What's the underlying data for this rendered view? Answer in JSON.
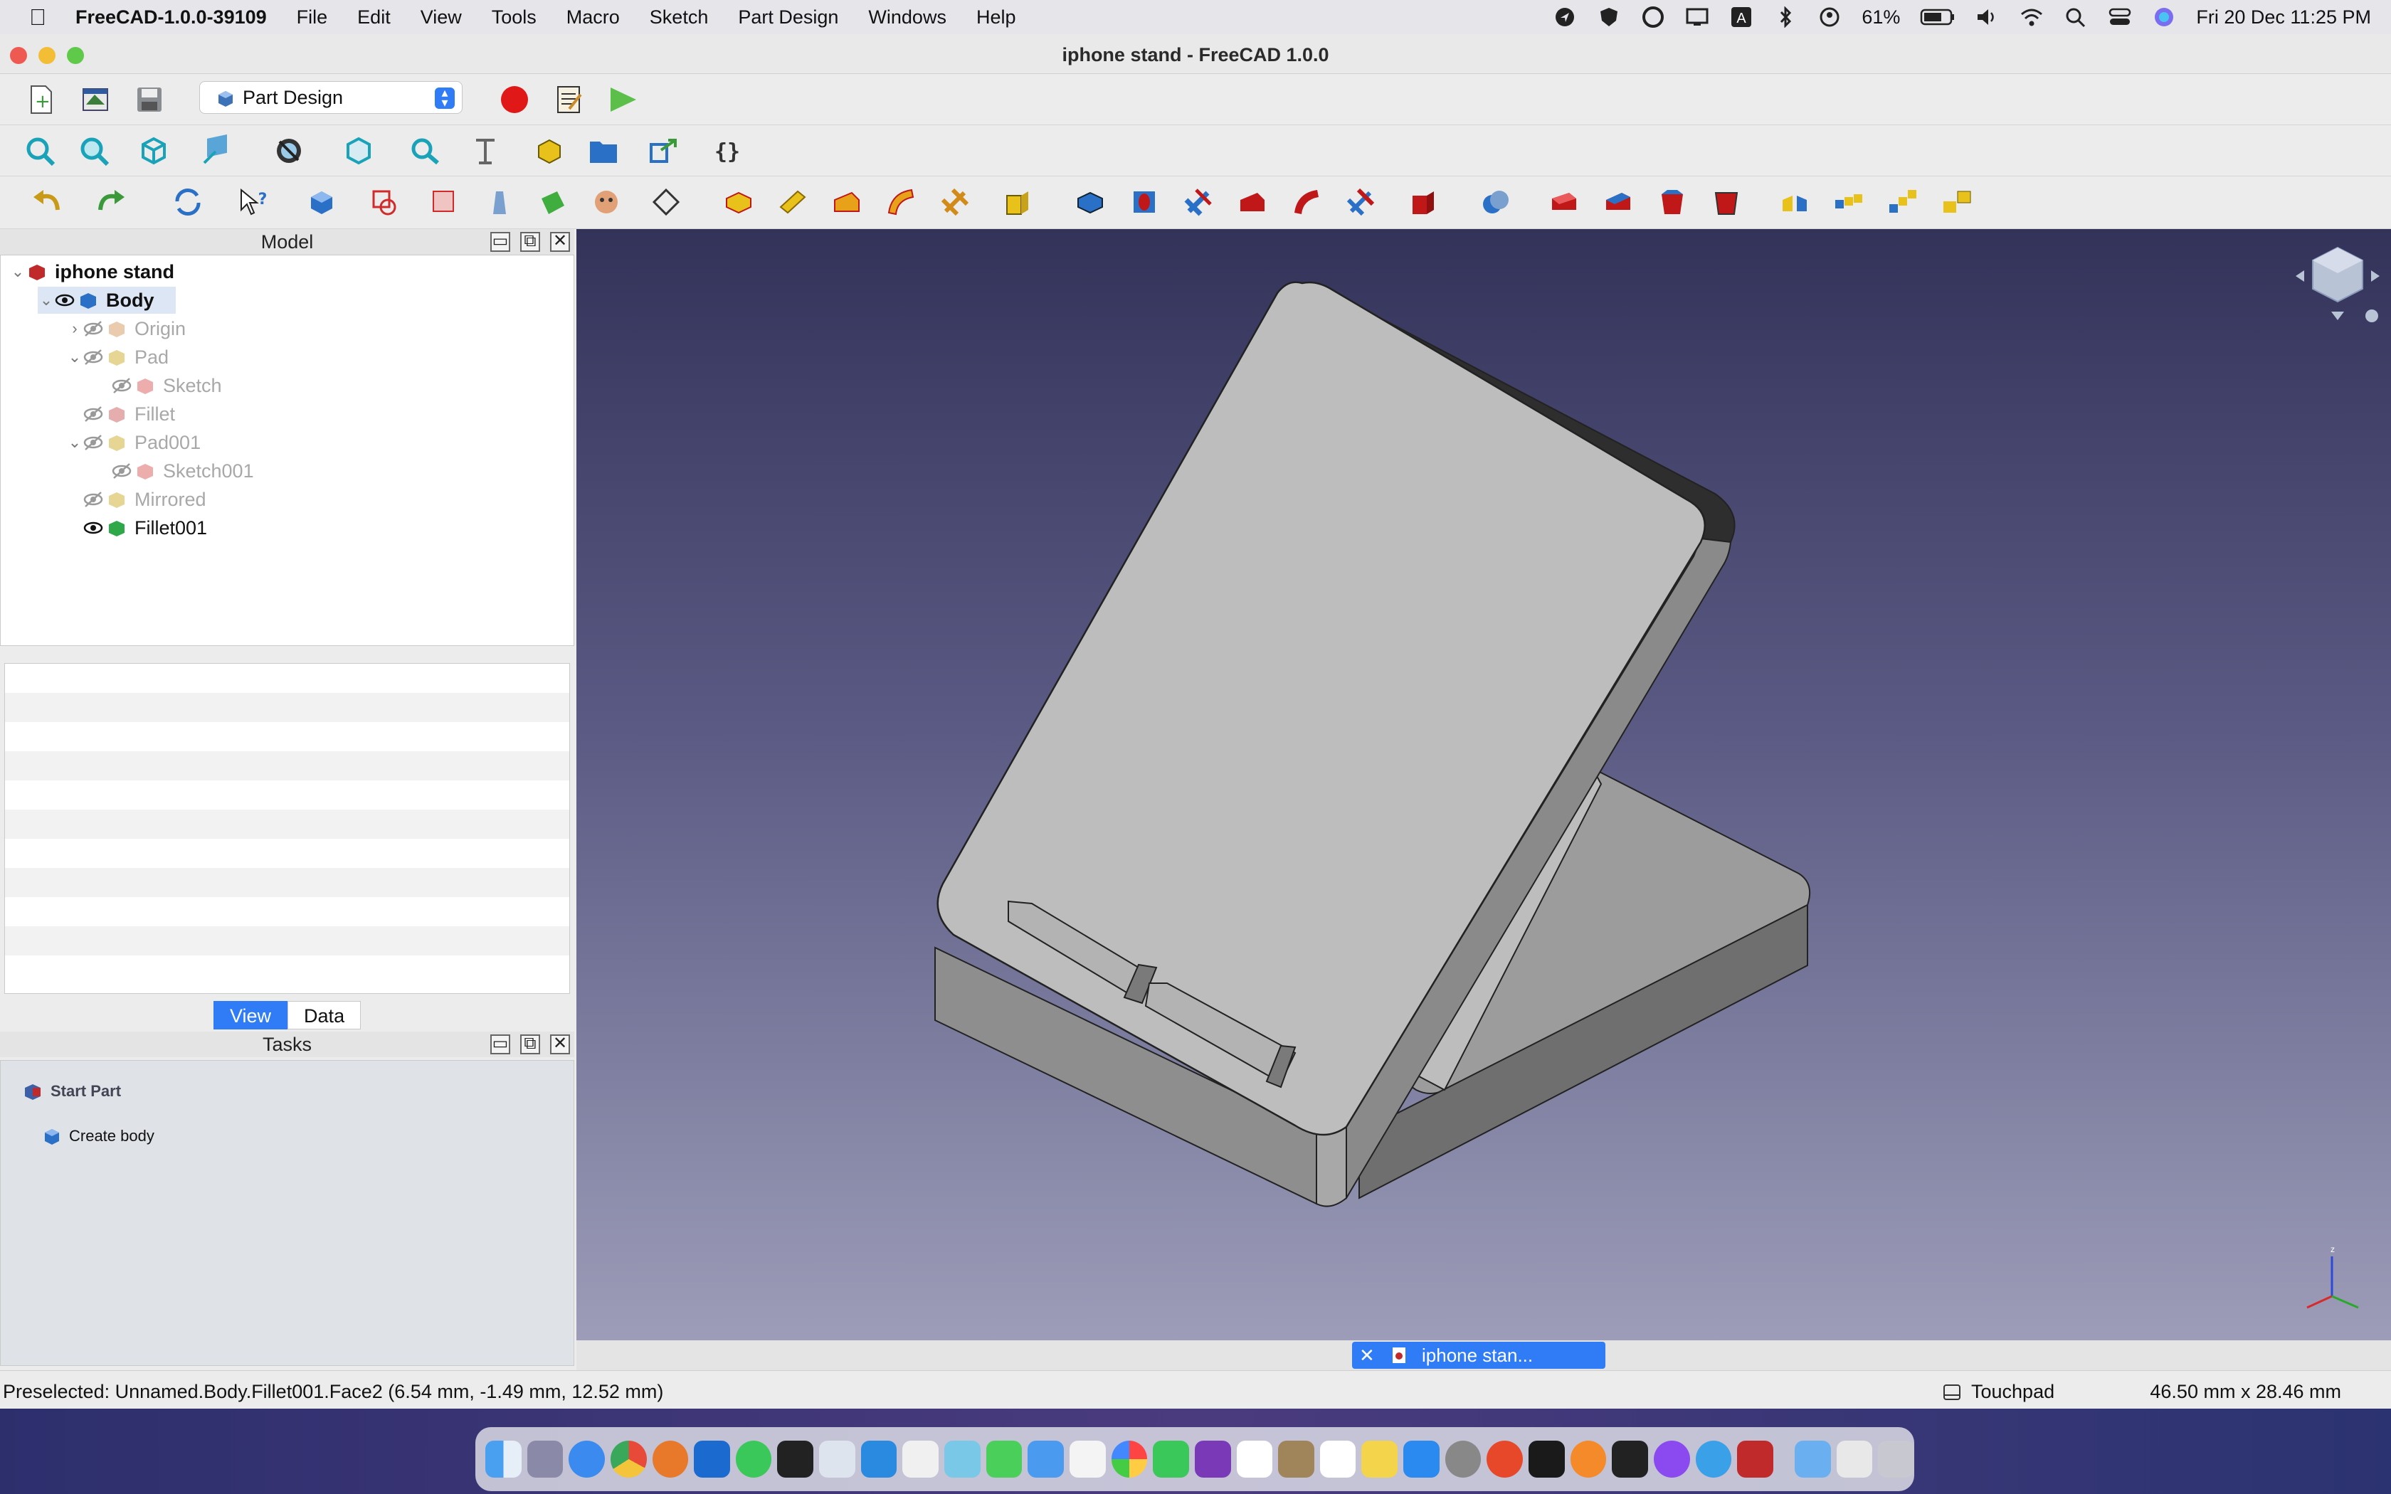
{
  "menubar": {
    "app_name": "FreeCAD-1.0.0-39109",
    "items": [
      "File",
      "Edit",
      "View",
      "Tools",
      "Macro",
      "Sketch",
      "Part Design",
      "Windows",
      "Help"
    ],
    "battery": "61%",
    "clock": "Fri 20 Dec  11:25 PM"
  },
  "window": {
    "title": "iphone stand - FreeCAD 1.0.0"
  },
  "toolbar": {
    "workbench": "Part Design"
  },
  "model_panel": {
    "title": "Model",
    "tree": [
      {
        "label": "iphone stand",
        "level": 0,
        "bold": true,
        "dim": false,
        "expanded": true
      },
      {
        "label": "Body",
        "level": 1,
        "bold": true,
        "dim": false,
        "expanded": true,
        "selected": true
      },
      {
        "label": "Origin",
        "level": 2,
        "dim": true,
        "expanded": false
      },
      {
        "label": "Pad",
        "level": 2,
        "dim": true,
        "expanded": true
      },
      {
        "label": "Sketch",
        "level": 3,
        "dim": true
      },
      {
        "label": "Fillet",
        "level": 2,
        "dim": true
      },
      {
        "label": "Pad001",
        "level": 2,
        "dim": true,
        "expanded": true
      },
      {
        "label": "Sketch001",
        "level": 3,
        "dim": true
      },
      {
        "label": "Mirrored",
        "level": 2,
        "dim": true
      },
      {
        "label": "Fillet001",
        "level": 2,
        "dim": false
      }
    ]
  },
  "property_tabs": {
    "view": "View",
    "data": "Data"
  },
  "tasks_panel": {
    "title": "Tasks",
    "section": "Start Part",
    "item": "Create body"
  },
  "document_tab": {
    "label": "iphone stan..."
  },
  "status_bar": {
    "message": "Preselected: Unnamed.Body.Fillet001.Face2 (6.54 mm, -1.49 mm, 12.52 mm)",
    "navigation": "Touchpad",
    "dimensions": "46.50 mm x 28.46 mm"
  },
  "colors": {
    "accent": "#2f7cf6",
    "view_top": "#33335a",
    "view_bottom": "#9d9db9",
    "model_face": "#bfbfbf"
  }
}
